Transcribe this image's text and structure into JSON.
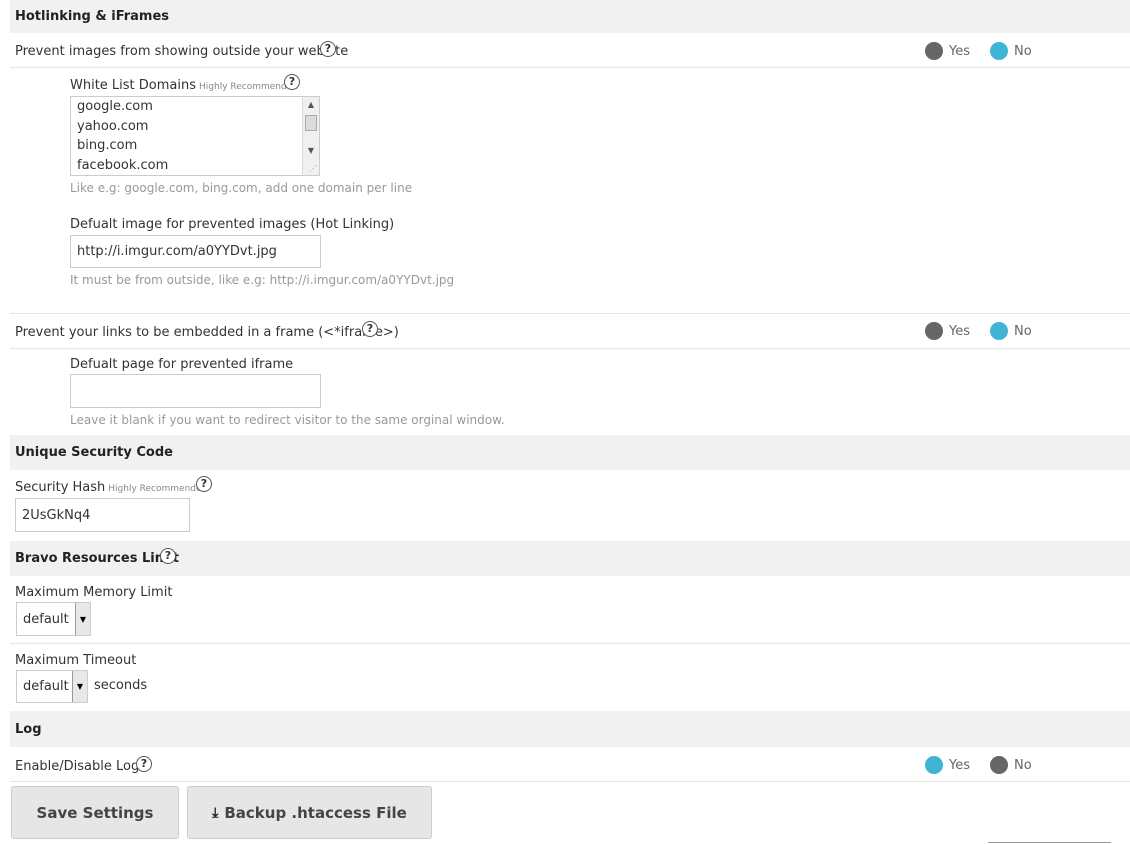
{
  "hotlinking": {
    "section_title": "Hotlinking & iFrames",
    "prevent_images_label": "Prevent images from showing outside your website",
    "prevent_images_yes": "Yes",
    "prevent_images_no": "No",
    "prevent_images_selected": "No",
    "whitelist_label": "White List Domains",
    "whitelist_badge": "Highly Recommended",
    "whitelist_domains": [
      "google.com",
      "yahoo.com",
      "bing.com",
      "facebook.com"
    ],
    "whitelist_hint": "Like e.g: google.com, bing.com, add one domain per line",
    "default_image_label": "Defualt image for prevented images (Hot Linking)",
    "default_image_value": "http://i.imgur.com/a0YYDvt.jpg",
    "default_image_hint": "It must be from outside, like e.g: http://i.imgur.com/a0YYDvt.jpg",
    "prevent_iframe_label": "Prevent your links to be embedded in a frame (<*iframe>)",
    "prevent_iframe_yes": "Yes",
    "prevent_iframe_no": "No",
    "prevent_iframe_selected": "No",
    "default_page_label": "Defualt page for prevented iframe",
    "default_page_value": "",
    "default_page_hint": "Leave it blank if you want to redirect visitor to the same orginal window."
  },
  "security": {
    "section_title": "Unique Security Code",
    "hash_label": "Security Hash",
    "hash_badge": "Highly Recommended",
    "hash_value": "2UsGkNq4"
  },
  "resources": {
    "section_title": "Bravo Resources Limit",
    "memory_label": "Maximum Memory Limit",
    "memory_value": "default",
    "timeout_label": "Maximum Timeout",
    "timeout_value": "default",
    "timeout_unit": "seconds"
  },
  "log": {
    "section_title": "Log",
    "enable_label": "Enable/Disable Log",
    "yes": "Yes",
    "no": "No",
    "selected": "Yes"
  },
  "actions": {
    "save_label": "Save Settings",
    "backup_label": "Backup .htaccess File"
  },
  "help_glyph": "?",
  "icons": {
    "help": "question-circle-icon",
    "download": "download-icon"
  },
  "colors": {
    "radio_on": "#3fb4d6",
    "radio_off": "#666666",
    "section_bg": "#f1f1f1"
  }
}
